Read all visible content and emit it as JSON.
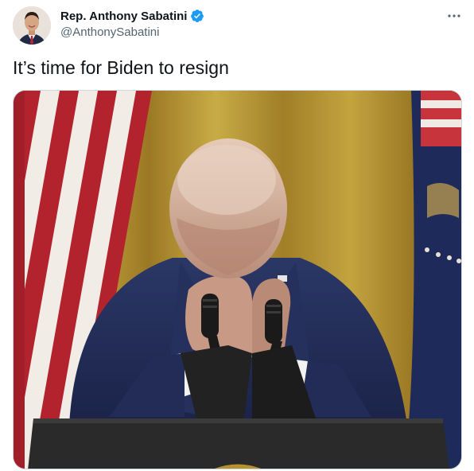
{
  "author": {
    "display_name": "Rep. Anthony Sabatini",
    "handle": "@AnthonySabatini",
    "verified": true,
    "avatar_icon": "profile-photo"
  },
  "tweet": {
    "text": "It’s time for Biden to resign"
  },
  "menu": {
    "icon": "more-horizontal-icon"
  },
  "colors": {
    "verified_blue": "#1d9bf0",
    "secondary_text": "#536471",
    "primary_text": "#0f1419",
    "border": "#cfd9de"
  }
}
